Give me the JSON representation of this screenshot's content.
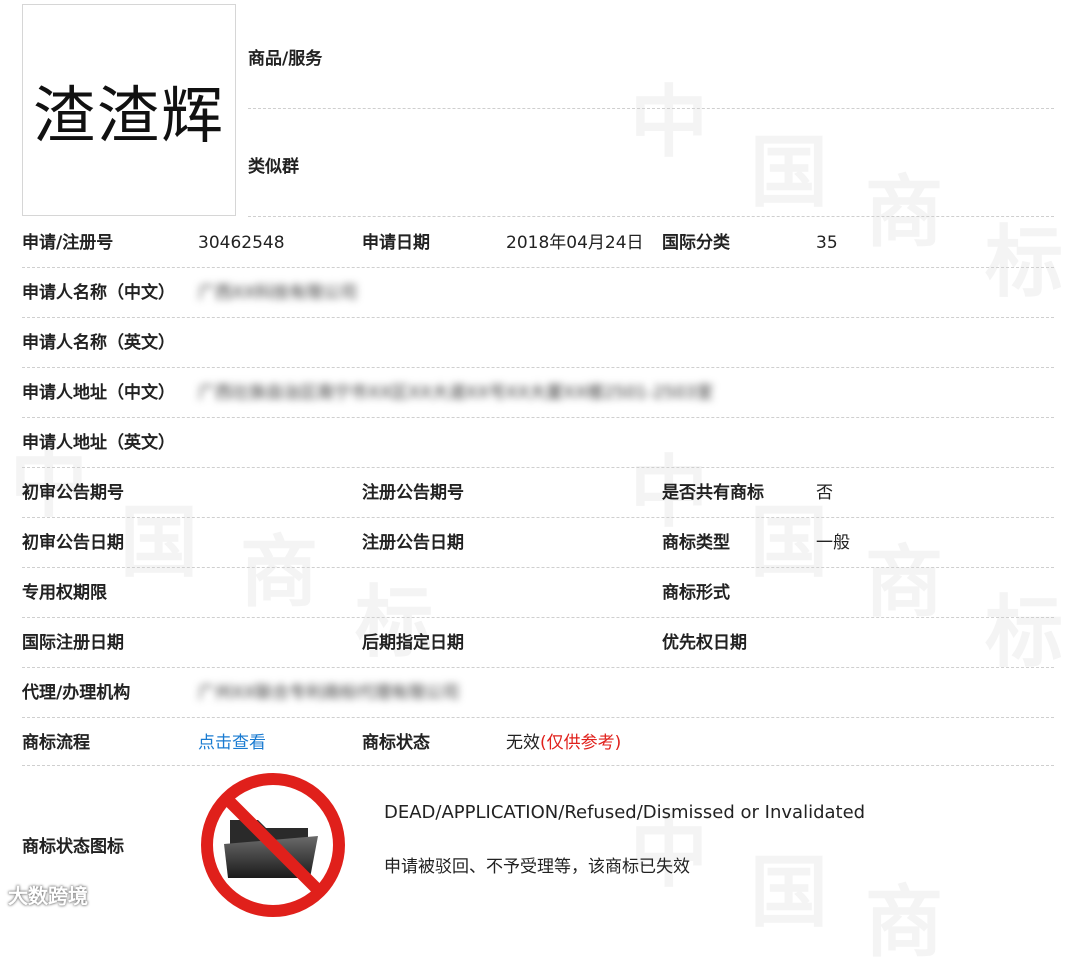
{
  "logo_text": "渣渣辉",
  "goods_services_label": "商品/服务",
  "similar_group_label": "类似群",
  "rows": {
    "reg_no": {
      "label": "申请/注册号",
      "value": "30462548"
    },
    "app_date": {
      "label": "申请日期",
      "value": "2018年04月24日"
    },
    "intl_class": {
      "label": "国际分类",
      "value": "35"
    },
    "applicant_cn": {
      "label": "申请人名称（中文）",
      "value": "广西XX科技有限公司"
    },
    "applicant_en": {
      "label": "申请人名称（英文）"
    },
    "address_cn": {
      "label": "申请人地址（中文）",
      "value": "广西壮族自治区南宁市XX区XX大道XX号XX大厦XX楼2501-2503室"
    },
    "address_en": {
      "label": "申请人地址（英文）"
    },
    "prelim_issue": {
      "label": "初审公告期号"
    },
    "reg_issue": {
      "label": "注册公告期号"
    },
    "shared": {
      "label": "是否共有商标",
      "value": "否"
    },
    "prelim_date": {
      "label": "初审公告日期"
    },
    "reg_date": {
      "label": "注册公告日期"
    },
    "mark_type": {
      "label": "商标类型",
      "value": "一般"
    },
    "exclusive_term": {
      "label": "专用权期限"
    },
    "mark_form": {
      "label": "商标形式"
    },
    "intl_reg_date": {
      "label": "国际注册日期"
    },
    "later_date": {
      "label": "后期指定日期"
    },
    "priority_date": {
      "label": "优先权日期"
    },
    "agent": {
      "label": "代理/办理机构",
      "value": "广州XX联合专利商标代理有限公司"
    },
    "process": {
      "label": "商标流程",
      "value": "点击查看"
    },
    "status": {
      "label": "商标状态",
      "value": "无效",
      "note": "(仅供参考)"
    }
  },
  "status_icon": {
    "label": "商标状态图标",
    "icon": "dead-folder-prohibited-icon",
    "en": "DEAD/APPLICATION/Refused/Dismissed or Invalidated",
    "cn": "申请被驳回、不予受理等，该商标已失效"
  },
  "watermark": {
    "chars": [
      "中",
      "国",
      "商",
      "标"
    ]
  },
  "brand": "大数跨境",
  "colors": {
    "link": "#1a7bd1",
    "status_note": "#e0201b",
    "prohibit": "#e0201b"
  }
}
